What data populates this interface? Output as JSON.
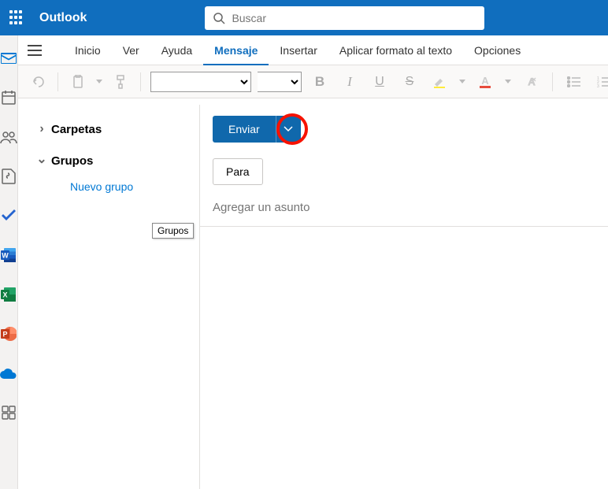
{
  "header": {
    "app_name": "Outlook",
    "search_placeholder": "Buscar"
  },
  "tabs": {
    "items": [
      {
        "label": "Inicio",
        "active": false
      },
      {
        "label": "Ver",
        "active": false
      },
      {
        "label": "Ayuda",
        "active": false
      },
      {
        "label": "Mensaje",
        "active": true
      },
      {
        "label": "Insertar",
        "active": false
      },
      {
        "label": "Aplicar formato al texto",
        "active": false
      },
      {
        "label": "Opciones",
        "active": false
      }
    ]
  },
  "sidebar": {
    "folders_label": "Carpetas",
    "groups_label": "Grupos",
    "new_group_label": "Nuevo grupo",
    "tooltip_text": "Grupos"
  },
  "compose": {
    "send_label": "Enviar",
    "to_label": "Para",
    "subject_placeholder": "Agregar un asunto"
  },
  "icons": {
    "mail": "mail-icon",
    "calendar": "calendar-icon",
    "people": "people-icon",
    "files": "files-icon",
    "todo": "todo-icon",
    "word": "word-icon",
    "excel": "excel-icon",
    "powerpoint": "powerpoint-icon",
    "onedrive": "onedrive-icon",
    "more": "more-icon"
  }
}
